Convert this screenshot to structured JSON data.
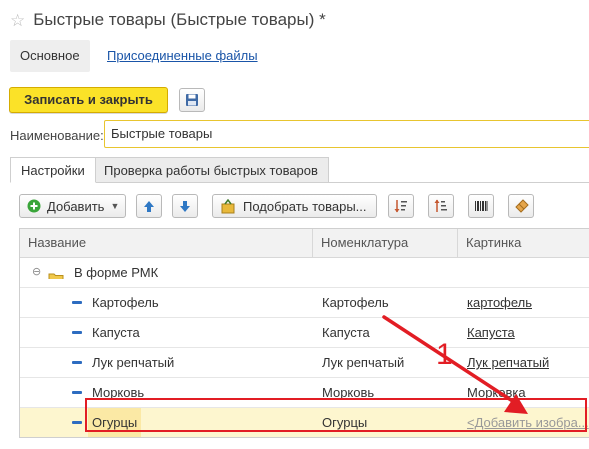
{
  "window": {
    "title": "Быстрые товары (Быстрые товары) *"
  },
  "sections": {
    "main": "Основное",
    "attachments": "Присоединенные файлы"
  },
  "toolbar": {
    "save_close_label": "Записать и закрыть"
  },
  "form": {
    "name_label": "Наименование:",
    "name_value": "Быстрые товары"
  },
  "tabs": [
    {
      "label": "Настройки",
      "active": true
    },
    {
      "label": "Проверка работы быстрых товаров",
      "active": false
    }
  ],
  "table_toolbar": {
    "add_label": "Добавить",
    "pick_label": "Подобрать товары..."
  },
  "table": {
    "columns": [
      "Название",
      "Номенклатура",
      "Картинка"
    ],
    "group": {
      "label": "В форме РМК"
    },
    "rows": [
      {
        "name": "Картофель",
        "item": "Картофель",
        "picture": "картофель"
      },
      {
        "name": "Капуста",
        "item": "Капуста",
        "picture": "Капуста"
      },
      {
        "name": "Лук репчатый",
        "item": "Лук репчатый",
        "picture": "Лук репчатый"
      },
      {
        "name": "Морковь",
        "item": "Морковь",
        "picture": "Морковка"
      },
      {
        "name": "Огурцы",
        "item": "Огурцы",
        "picture": "<Добавить изобра..."
      }
    ]
  },
  "annotation": {
    "number": "1"
  },
  "colors": {
    "accent_yellow": "#fbe228",
    "annotation_red": "#e21d24",
    "link_blue": "#1a55a8"
  }
}
